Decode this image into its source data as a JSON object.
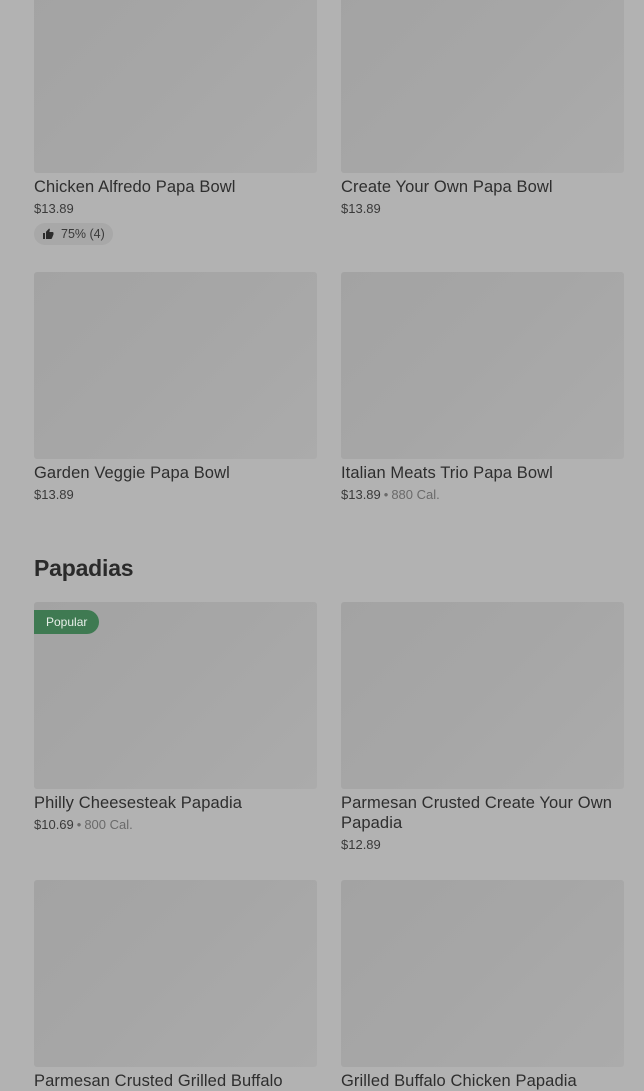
{
  "bowls": [
    {
      "title": "Chicken Alfredo Papa Bowl",
      "price": "$13.89",
      "rating": "75% (4)"
    },
    {
      "title": "Create Your Own Papa Bowl",
      "price": "$13.89"
    },
    {
      "title": "Garden Veggie Papa Bowl",
      "price": "$13.89"
    },
    {
      "title": "Italian Meats Trio Papa Bowl",
      "price": "$13.89",
      "calories": "880 Cal."
    }
  ],
  "papadias_section": {
    "title": "Papadias"
  },
  "papadias": [
    {
      "title": "Philly Cheesesteak Papadia",
      "price": "$10.69",
      "calories": "800 Cal.",
      "badge": "Popular"
    },
    {
      "title": "Parmesan Crusted Create Your Own Papadia",
      "price": "$12.89"
    },
    {
      "title": "Parmesan Crusted Grilled Buffalo"
    },
    {
      "title": "Grilled Buffalo Chicken Papadia"
    }
  ],
  "separator": "•",
  "colors": {
    "background": "#b2b2b2",
    "badge": "#3f7a52",
    "text": "#2e2e2e"
  },
  "icons": {
    "rating": "thumbs-up-icon"
  }
}
